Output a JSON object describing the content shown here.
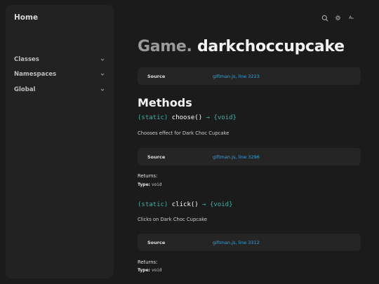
{
  "sidebar": {
    "home_label": "Home",
    "items": [
      {
        "label": "Classes"
      },
      {
        "label": "Namespaces"
      },
      {
        "label": "Global"
      }
    ]
  },
  "toolbar": {
    "icons": [
      "search-icon",
      "settings-icon",
      "font-size-icon"
    ],
    "font_toggle_label": "Aₐ"
  },
  "header": {
    "namespace": "Game.",
    "name": "darkchoccupcake"
  },
  "source": {
    "label": "Source",
    "file": "giftman.js",
    "line": "line 3223"
  },
  "methods": {
    "title": "Methods",
    "items": [
      {
        "static": "(static)",
        "name": "choose()",
        "returns": "→ {void}",
        "description": "Chooses effect for Dark Choc Cupcake",
        "source_label": "Source",
        "source_file": "giftman.js",
        "source_line": "line 3296",
        "returns_label": "Returns:",
        "type_label": "Type:",
        "type_value": "void"
      },
      {
        "static": "(static)",
        "name": "click()",
        "returns": "→ {void}",
        "description": "Clicks on Dark Choc Cupcake",
        "source_label": "Source",
        "source_file": "giftman.js",
        "source_line": "line 3312",
        "returns_label": "Returns:",
        "type_label": "Type:",
        "type_value": "void"
      }
    ]
  },
  "colors": {
    "background": "#1b1b1b",
    "panel": "#222222",
    "link": "#3fa1d6",
    "keyword": "#3bb3a6"
  }
}
